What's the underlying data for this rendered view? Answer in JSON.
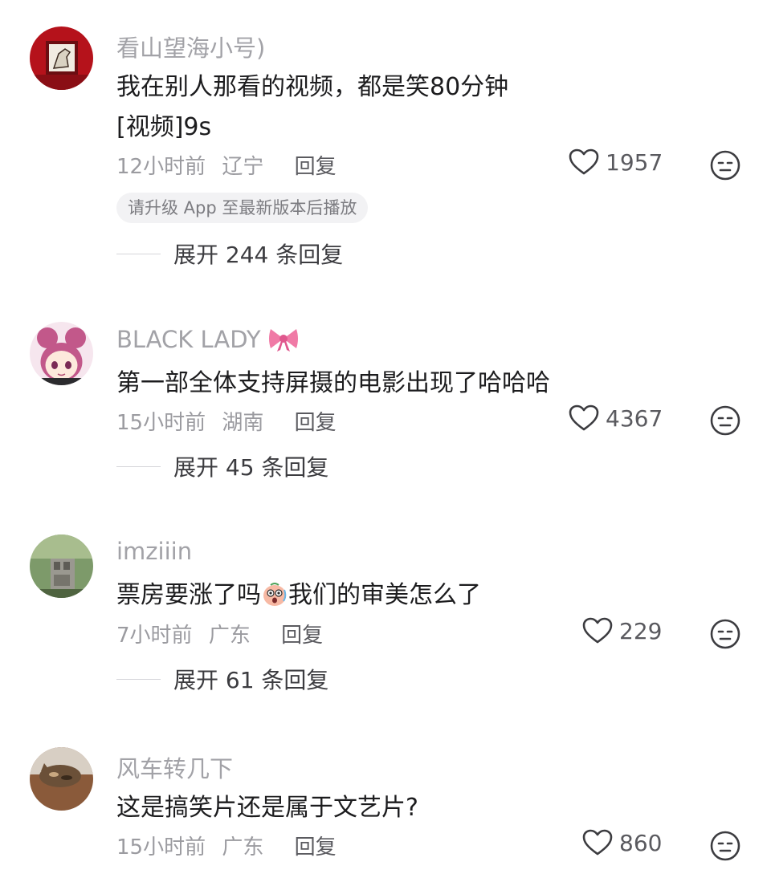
{
  "comments": [
    {
      "username": "看山望海小号)",
      "text": "我在别人那看的视频，都是笑80分钟",
      "text2": "[视频]9s",
      "time": "12小时前",
      "location": "辽宁",
      "reply_label": "回复",
      "likes": "1957",
      "upgrade_notice": "请升级 App 至最新版本后播放",
      "expand_label": "展开 244 条回复",
      "avatar_icon": "horse-painting-avatar"
    },
    {
      "username": "BLACK LADY",
      "username_icon": "pink-bow-icon",
      "text": "第一部全体支持屏摄的电影出现了哈哈哈",
      "time": "15小时前",
      "location": "湖南",
      "reply_label": "回复",
      "likes": "4367",
      "expand_label": "展开 45 条回复",
      "avatar_icon": "anime-girl-avatar"
    },
    {
      "username": "imziiin",
      "text_before_emoji": "票房要涨了吗",
      "text_after_emoji": "我们的审美怎么了",
      "inline_emoji": "shocked-face-emoji",
      "time": "7小时前",
      "location": "广东",
      "reply_label": "回复",
      "likes": "229",
      "expand_label": "展开 61 条回复",
      "avatar_icon": "statue-garden-avatar"
    },
    {
      "username": "风车转几下",
      "text": "这是搞笑片还是属于文艺片?",
      "time": "15小时前",
      "location": "广东",
      "reply_label": "回复",
      "likes": "860",
      "avatar_icon": "cat-avatar"
    }
  ],
  "colors": {
    "username": "#a2a2a7",
    "text": "#1c1c1e",
    "meta": "#9b9ba0",
    "accent_bow": "#f07aa6"
  }
}
